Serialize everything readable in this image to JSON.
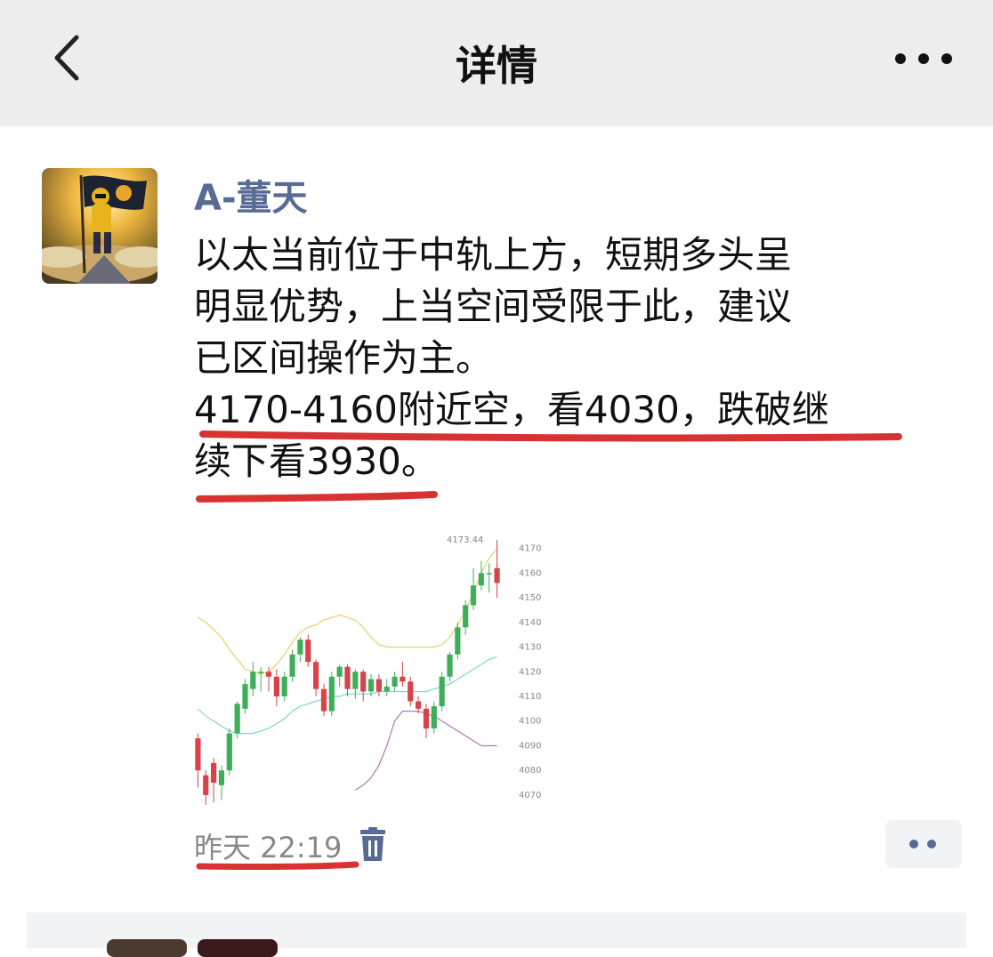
{
  "header": {
    "title": "详情"
  },
  "post": {
    "author": "A-董天",
    "lines": [
      "以太当前位于中轨上方，短期多头呈",
      "明显优势，上当空间受限于此，建议",
      "已区间操作为主。",
      "4170-4160附近空，看4030，跌破继",
      "续下看3930。"
    ],
    "time": "昨天 22:19"
  },
  "chart_data": {
    "type": "candlestick",
    "y_ticks": [
      4170,
      4160,
      4150,
      4140,
      4130,
      4120,
      4110,
      4100,
      4090,
      4080,
      4070
    ],
    "ylim": [
      4066,
      4176
    ],
    "high_label": "4173.44",
    "candles": [
      {
        "o": 4093,
        "c": 4080,
        "h": 4095,
        "l": 4073
      },
      {
        "o": 4078,
        "c": 4070,
        "h": 4080,
        "l": 4066
      },
      {
        "o": 4083,
        "c": 4075,
        "h": 4085,
        "l": 4067
      },
      {
        "o": 4074,
        "c": 4080,
        "h": 4082,
        "l": 4068
      },
      {
        "o": 4080,
        "c": 4095,
        "h": 4097,
        "l": 4078
      },
      {
        "o": 4095,
        "c": 4107,
        "h": 4108,
        "l": 4093
      },
      {
        "o": 4105,
        "c": 4115,
        "h": 4117,
        "l": 4103
      },
      {
        "o": 4113,
        "c": 4120,
        "h": 4124,
        "l": 4110
      },
      {
        "o": 4120,
        "c": 4120,
        "h": 4122,
        "l": 4112
      },
      {
        "o": 4120,
        "c": 4118,
        "h": 4122,
        "l": 4112
      },
      {
        "o": 4118,
        "c": 4110,
        "h": 4121,
        "l": 4106
      },
      {
        "o": 4110,
        "c": 4118,
        "h": 4120,
        "l": 4108
      },
      {
        "o": 4118,
        "c": 4127,
        "h": 4129,
        "l": 4116
      },
      {
        "o": 4127,
        "c": 4133,
        "h": 4134,
        "l": 4124
      },
      {
        "o": 4133,
        "c": 4124,
        "h": 4135,
        "l": 4122
      },
      {
        "o": 4124,
        "c": 4113,
        "h": 4125,
        "l": 4110
      },
      {
        "o": 4113,
        "c": 4104,
        "h": 4115,
        "l": 4102
      },
      {
        "o": 4104,
        "c": 4118,
        "h": 4120,
        "l": 4102
      },
      {
        "o": 4118,
        "c": 4122,
        "h": 4123,
        "l": 4114
      },
      {
        "o": 4122,
        "c": 4113,
        "h": 4123,
        "l": 4110
      },
      {
        "o": 4113,
        "c": 4120,
        "h": 4121,
        "l": 4109
      },
      {
        "o": 4120,
        "c": 4112,
        "h": 4121,
        "l": 4108
      },
      {
        "o": 4112,
        "c": 4117,
        "h": 4119,
        "l": 4110
      },
      {
        "o": 4117,
        "c": 4112,
        "h": 4119,
        "l": 4110
      },
      {
        "o": 4112,
        "c": 4114,
        "h": 4117,
        "l": 4110
      },
      {
        "o": 4114,
        "c": 4118,
        "h": 4120,
        "l": 4112
      },
      {
        "o": 4118,
        "c": 4116,
        "h": 4124,
        "l": 4114
      },
      {
        "o": 4116,
        "c": 4108,
        "h": 4118,
        "l": 4106
      },
      {
        "o": 4108,
        "c": 4105,
        "h": 4110,
        "l": 4103
      },
      {
        "o": 4105,
        "c": 4097,
        "h": 4107,
        "l": 4093
      },
      {
        "o": 4097,
        "c": 4106,
        "h": 4108,
        "l": 4095
      },
      {
        "o": 4106,
        "c": 4118,
        "h": 4120,
        "l": 4104
      },
      {
        "o": 4118,
        "c": 4127,
        "h": 4128,
        "l": 4116
      },
      {
        "o": 4127,
        "c": 4138,
        "h": 4140,
        "l": 4125
      },
      {
        "o": 4138,
        "c": 4147,
        "h": 4149,
        "l": 4135
      },
      {
        "o": 4147,
        "c": 4155,
        "h": 4162,
        "l": 4145
      },
      {
        "o": 4155,
        "c": 4160,
        "h": 4165,
        "l": 4153
      },
      {
        "o": 4160,
        "c": 4160,
        "h": 4164,
        "l": 4152
      },
      {
        "o": 4162,
        "c": 4156,
        "h": 4173.44,
        "l": 4150
      }
    ],
    "upper_band": [
      4142,
      4140,
      4137,
      4134,
      4129,
      4125,
      4121,
      4120,
      4119,
      4120,
      4123,
      4127,
      4132,
      4136,
      4138,
      4139,
      4141,
      4142,
      4143,
      4142,
      4141,
      4138,
      4134,
      4131,
      4130,
      4130,
      4130,
      4130,
      4130,
      4130,
      4130,
      4131,
      4134,
      4139,
      4145,
      4152,
      4160,
      4166,
      4170
    ],
    "middle_band": [
      4105,
      4102,
      4100,
      4098,
      4096,
      4095,
      4095,
      4095,
      4096,
      4097,
      4099,
      4101,
      4104,
      4106,
      4107,
      4108,
      4109,
      4110,
      4110,
      4111,
      4111,
      4111,
      4111,
      4112,
      4112,
      4112,
      4112,
      4112,
      4112,
      4112,
      4113,
      4114,
      4115,
      4117,
      4119,
      4121,
      4123,
      4125,
      4126
    ],
    "lower_band": [
      null,
      null,
      null,
      null,
      null,
      null,
      null,
      null,
      null,
      null,
      null,
      null,
      null,
      null,
      null,
      null,
      null,
      null,
      null,
      null,
      4072,
      4074,
      4077,
      4082,
      4090,
      4100,
      4104,
      4104,
      4104,
      4103,
      4102,
      4100,
      4098,
      4096,
      4094,
      4092,
      4090,
      4090,
      4090
    ],
    "colors": {
      "up": "#3fae5a",
      "down": "#d9424a",
      "upper_band": "#e6cf6a",
      "middle_band": "#7dd6d0",
      "lower_band": "#b07aae",
      "tick": "#888888",
      "annotation_underline": "#d83333",
      "link_blue": "#576b95"
    }
  },
  "icons": {
    "back": "chevron-left-icon",
    "more": "more-dots-icon",
    "trash": "trash-icon",
    "comment": "comment-dots-icon"
  }
}
